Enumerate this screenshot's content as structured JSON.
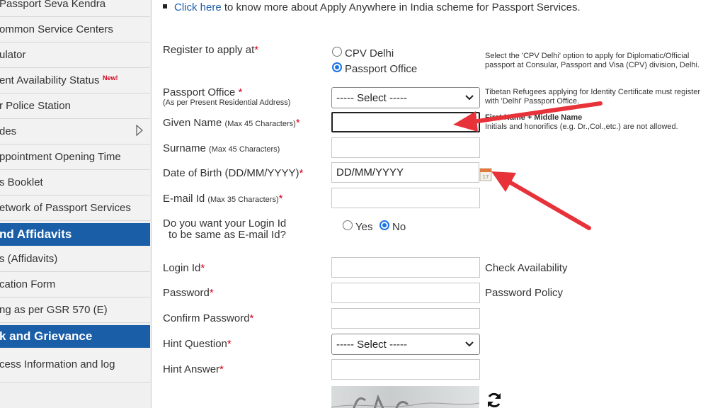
{
  "sidebar": {
    "items": [
      {
        "label": "Passport Seva Kendra"
      },
      {
        "label": "ommon Service Centers"
      },
      {
        "label": "ulator"
      },
      {
        "label": "ent Availability Status",
        "badge": "New!"
      },
      {
        "label": "r Police Station"
      },
      {
        "label": "des"
      },
      {
        "label": "ppointment Opening Time"
      },
      {
        "label": "s Booklet"
      },
      {
        "label": "etwork of Passport Services"
      },
      {
        "label": "s (Affidavits)"
      },
      {
        "label": "cation Form"
      },
      {
        "label": "ng as per GSR 570 (E)"
      },
      {
        "label": "cess Information and log"
      }
    ],
    "headings": [
      {
        "label": "nd Affidavits"
      },
      {
        "label": "k and Grievance"
      }
    ]
  },
  "main": {
    "intro": {
      "link": "Click here",
      "text": " to know more about Apply Anywhere in India scheme for Passport Services."
    },
    "register": {
      "label": "Register to apply at",
      "options": [
        "CPV Delhi",
        "Passport Office"
      ],
      "selected": "Passport Office",
      "note_lines": [
        "Select the 'CPV Delhi' option to apply for Diplomatic/Official",
        "passport at Consular, Passport and Visa (CPV) division, Delhi."
      ]
    },
    "passport_office": {
      "label": "Passport Office",
      "sub": "(As per Present Residential Address)",
      "select": "----- Select -----",
      "note_lines": [
        "Tibetan Refugees applying for Identity Certificate must register",
        "with 'Delhi' Passport Office."
      ]
    },
    "given_name": {
      "label": "Given Name",
      "hint": "(Max 45 Characters)",
      "value": "",
      "note_bold": "First Name + Middle Name",
      "note": "Initials and honorifics (e.g. Dr.,Col.,etc.) are not allowed."
    },
    "surname": {
      "label": "Surname",
      "hint": "(Max 45 Characters)",
      "value": ""
    },
    "dob": {
      "label": "Date of Birth (DD/MM/YYYY)",
      "value": "DD/MM/YYYY"
    },
    "email": {
      "label": "E-mail Id",
      "hint": "(Max 35 Characters)",
      "value": ""
    },
    "same_login": {
      "label_lines": [
        "Do you want your Login Id",
        "to be same as E-mail Id?"
      ],
      "options": [
        "Yes",
        "No"
      ],
      "selected": "No"
    },
    "login_id": {
      "label": "Login Id",
      "value": "",
      "link": "Check Availability"
    },
    "password": {
      "label": "Password",
      "value": "",
      "link": "Password Policy"
    },
    "confirm_password": {
      "label": "Confirm Password",
      "value": ""
    },
    "hint_question": {
      "label": "Hint Question",
      "select": "----- Select -----"
    },
    "hint_answer": {
      "label": "Hint Answer",
      "value": ""
    },
    "required_mark": "*"
  },
  "colors": {
    "sidebar_heading": "#1a5ea8",
    "link": "#1a5ea8",
    "required": "#d0021b",
    "annotation_arrow": "#e8323a"
  }
}
